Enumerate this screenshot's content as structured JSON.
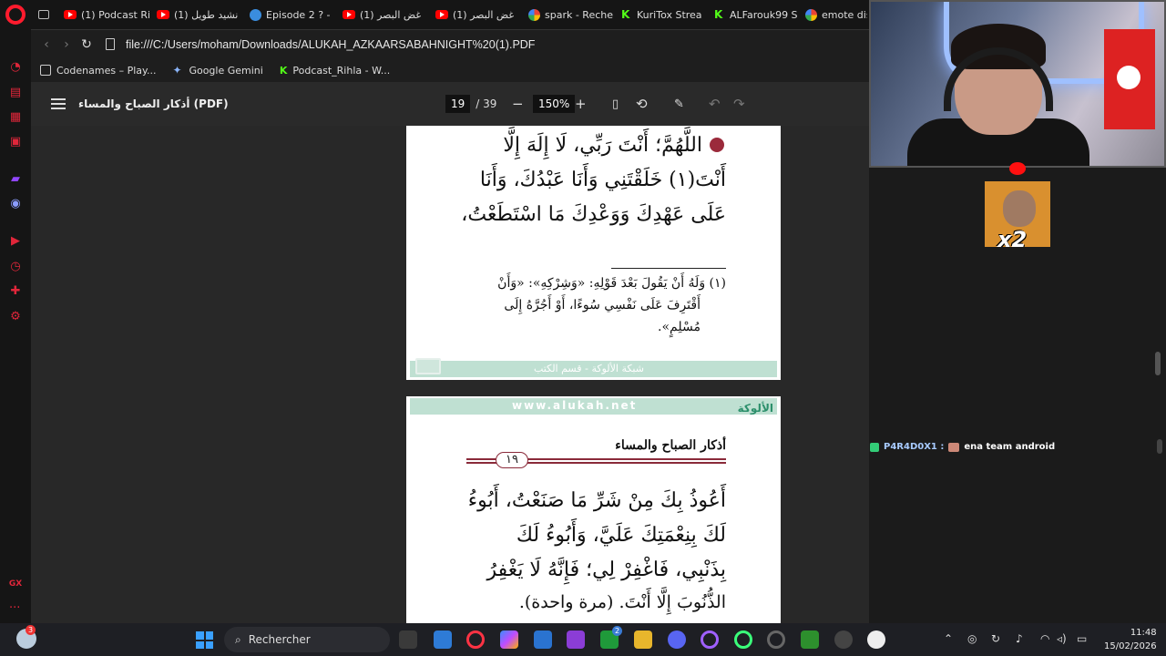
{
  "browser": {
    "tabs": [
      {
        "label": "(1) Podcast Ri",
        "icon": "youtube-icon"
      },
      {
        "label": "(1) نشيد طويل",
        "icon": "youtube-icon"
      },
      {
        "label": "Episode 2 ? -",
        "icon": "chrome-icon"
      },
      {
        "label": "(1) غض البصر",
        "icon": "youtube-icon"
      },
      {
        "label": "(1) غض البصر",
        "icon": "youtube-icon"
      },
      {
        "label": "spark - Reche",
        "icon": "google-icon"
      },
      {
        "label": "KuriTox Strea",
        "icon": "kick-icon"
      },
      {
        "label": "ALFarouk99 S",
        "icon": "kick-icon"
      },
      {
        "label": "emote dis",
        "icon": "google-icon"
      }
    ],
    "url": "file:///C:/Users/moham/Downloads/ALUKAH_AZKAARSABAHNIGHT%20(1).PDF",
    "bookmarks": [
      {
        "label": "Codenames – Play...",
        "icon": "folder-icon"
      },
      {
        "label": "Google Gemini",
        "icon": "gemini-icon"
      },
      {
        "label": "Podcast_Rihla - W...",
        "icon": "kick-icon"
      }
    ]
  },
  "pdf": {
    "title": "أذكار الصباح والمساء (PDF)",
    "page_current": "19",
    "page_total": "/ 39",
    "zoom": "150%",
    "page1": {
      "lines": [
        "اللَّهُمَّ؛ أَنْتَ رَبِّي، لَا إِلَهَ إِلَّا",
        "أَنْتَ(١) خَلَقْتَنِي وَأَنَا عَبْدُكَ، وَأَنَا",
        "عَلَى عَهْدِكَ وَوَعْدِكَ مَا اسْتَطَعْتُ،"
      ],
      "footnote": [
        "(١) وَلَهُ أَنْ يَقُولَ بَعْدَ قَوْلِهِ: «وَشِرْكِهِ»: «وَأَنْ",
        "أَقْتَرِفَ عَلَى نَفْسِي سُوءًا، أَوْ أَجُرَّهُ إِلَى",
        "مُسْلِمٍ»."
      ],
      "footer": "شبكة الألوكة - قسم الكتب"
    },
    "page2": {
      "website": "www.alukah.net",
      "brand": "الألوكة",
      "heading": "أذكار الصباح والمساء",
      "page_number": "١٩",
      "lines": [
        "أَعُوذُ بِكَ مِنْ شَرِّ مَا صَنَعْتُ، أَبُوءُ",
        "لَكَ بِنِعْمَتِكَ عَلَيَّ، وَأَبُوءُ لَكَ",
        "بِذَنْبِي، فَاغْفِرْ لِي؛ فَإِنَّهُ لَا يَغْفِرُ",
        "الذُّنُوبَ إِلَّا أَنْتَ. (مرة واحدة)."
      ]
    }
  },
  "stream": {
    "emote_multiplier": "x2",
    "chat_user": "P4R4D0X1 :",
    "chat_message": "ena team android"
  },
  "taskbar": {
    "search_placeholder": "Rechercher",
    "notification_count": "3",
    "pinned_badge": "2",
    "time": "11:48",
    "date": "15/02/2026"
  },
  "sidebar": {
    "gx_label": "GX"
  }
}
